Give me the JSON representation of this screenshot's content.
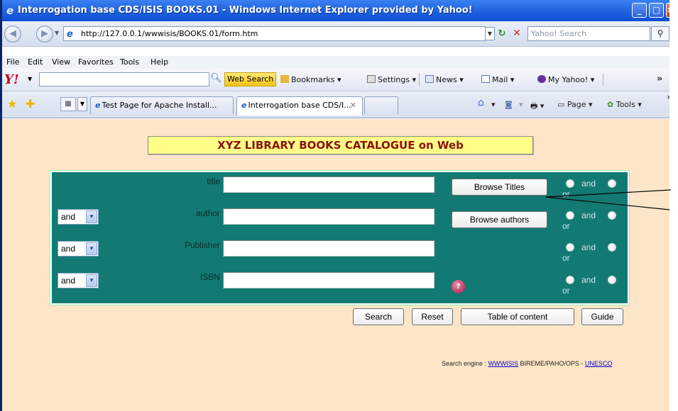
{
  "window": {
    "title": "Interrogation base CDS/ISIS BOOKS.01 - Windows Internet Explorer provided by Yahoo!"
  },
  "address": {
    "url": "http://127.0.0.1/wwwisis/BOOKS.01/form.htm",
    "search_placeholder": "Yahoo! Search"
  },
  "menu": [
    "File",
    "Edit",
    "View",
    "Favorites",
    "Tools",
    "Help"
  ],
  "yahoo_toolbar": {
    "web_search": "Web Search",
    "bookmarks": "Bookmarks",
    "settings": "Settings",
    "news": "News",
    "mail": "Mail",
    "my_yahoo": "My Yahoo!"
  },
  "tabs": [
    {
      "label": "Test Page for Apache Install..."
    },
    {
      "label": "Interrogation base CDS/I..."
    }
  ],
  "commands": {
    "page": "Page",
    "tools": "Tools"
  },
  "page": {
    "heading": "XYZ LIBRARY BOOKS CATALOGUE on Web",
    "fields": [
      {
        "label": "title",
        "operator": null,
        "value": ""
      },
      {
        "label": "author",
        "operator": "and",
        "value": ""
      },
      {
        "label": "Publisher",
        "operator": "and",
        "value": ""
      },
      {
        "label": "ISBN",
        "operator": "and",
        "value": ""
      }
    ],
    "browse_titles": "Browse Titles",
    "browse_authors": "Browse authors",
    "radio_and": "and",
    "radio_or": "or",
    "buttons": {
      "search": "Search",
      "reset": "Reset",
      "toc": "Table of content",
      "guide": "Guide"
    },
    "footer": {
      "prefix": "Search engine : ",
      "wwwisis": "WWWISIS",
      "middle": " BIREME/PAHO/OPS - ",
      "unesco": "UNESCO"
    }
  },
  "colors": {
    "titlebar": "#2466e0",
    "page_background": "#fde6c8",
    "panel": "#127a72",
    "heading_bg": "#ffff88",
    "heading_text": "#8b1111"
  }
}
